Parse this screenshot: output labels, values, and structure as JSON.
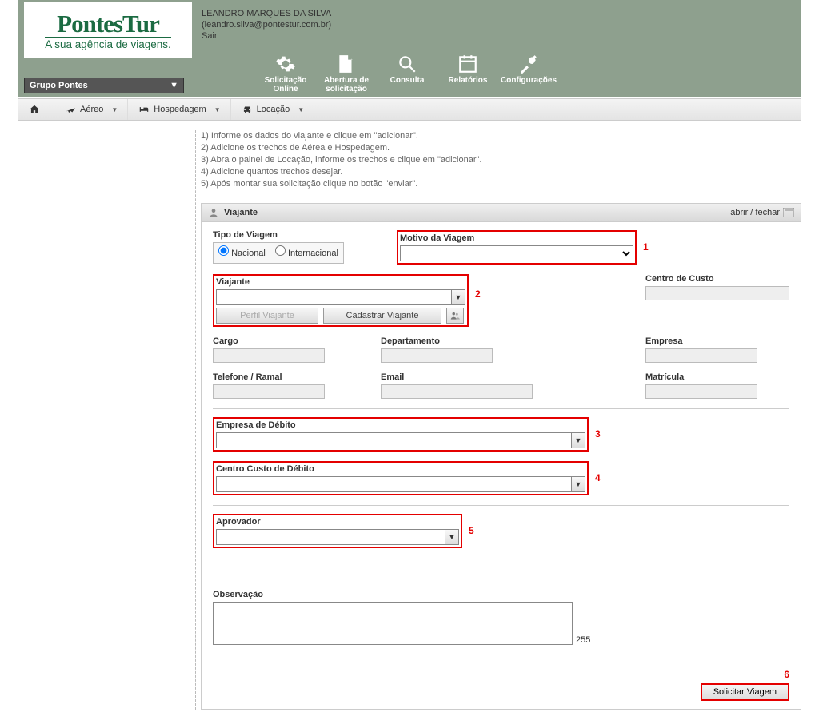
{
  "logo": {
    "main": "PontesTur",
    "tagline": "A sua agência de viagens."
  },
  "user": {
    "name": "LEANDRO MARQUES DA SILVA",
    "email": "(leandro.silva@pontestur.com.br)",
    "logout": "Sair"
  },
  "clientSelector": "Grupo Pontes",
  "mainnav": {
    "solicitacao": "Solicitação Online",
    "abertura": "Abertura de solicitação",
    "consulta": "Consulta",
    "relatorios": "Relatórios",
    "configuracoes": "Configurações"
  },
  "tabs": {
    "aereo": "Aéreo",
    "hospedagem": "Hospedagem",
    "locacao": "Locação"
  },
  "instructions": [
    "1) Informe os dados do viajante e clique em \"adicionar\".",
    "2) Adicione os trechos de Aérea e Hospedagem.",
    "3) Abra o painel de Locação, informe os trechos e clique em \"adicionar\".",
    "4) Adicione quantos trechos desejar.",
    "5) Após montar sua solicitação clique no botão \"enviar\"."
  ],
  "panel": {
    "title": "Viajante",
    "toggle": "abrir / fechar"
  },
  "labels": {
    "tipoViagem": "Tipo de Viagem",
    "nacional": "Nacional",
    "internacional": "Internacional",
    "motivoViagem": "Motivo da Viagem",
    "viajante": "Viajante",
    "perfilViajante": "Perfil Viajante",
    "cadastrarViajante": "Cadastrar Viajante",
    "centroCusto": "Centro de Custo",
    "cargo": "Cargo",
    "departamento": "Departamento",
    "empresa": "Empresa",
    "telefone": "Telefone / Ramal",
    "email": "Email",
    "matricula": "Matrícula",
    "empresaDebito": "Empresa de Débito",
    "centroCustoDebito": "Centro Custo de Débito",
    "aprovador": "Aprovador",
    "observacao": "Observação",
    "charLimit": "255",
    "solicitarViagem": "Solicitar Viagem"
  },
  "callouts": {
    "c1": "1",
    "c2": "2",
    "c3": "3",
    "c4": "4",
    "c5": "5",
    "c6": "6"
  },
  "values": {
    "motivoViagem": "",
    "viajante": "",
    "centroCusto": "",
    "cargo": "",
    "departamento": "",
    "empresa": "",
    "telefone": "",
    "email": "",
    "matricula": "",
    "empresaDebito": "",
    "centroCustoDebito": "",
    "aprovador": "",
    "observacao": ""
  }
}
